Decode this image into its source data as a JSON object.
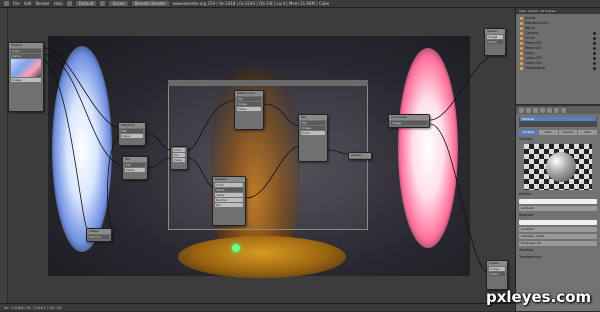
{
  "topbar": {
    "menus": [
      "File",
      "Add",
      "Render",
      "Help"
    ],
    "layout": "Default",
    "scene": "Scene",
    "engine": "Blender Render",
    "info": "www.blender.org 259 | Ve:3418 | Fa:3244 | Ob:1/8 | La:4 | Mem:31.84M | Cube"
  },
  "outliner": {
    "header_tabs": [
      "View",
      "Search",
      "All Scenes"
    ],
    "items": [
      "Scene",
      "RenderLayers",
      "World",
      "Camera",
      "Circle",
      "Plane.001",
      "Plane.002",
      "Lamp",
      "Lamp.001",
      "Lamp.002",
      "Trophy.Base"
    ]
  },
  "properties": {
    "material_name": "Material",
    "tabs": [
      "Surface",
      "Wire",
      "Volume",
      "Halo"
    ],
    "preview_title": "Preview",
    "diffuse_title": "Diffuse",
    "diffuse_shader": "Lambert",
    "specular_title": "Specular",
    "specular_shader": "CookTorr",
    "intensity_label": "Intensity: 0.500",
    "hardness_label": "Hardness: 50",
    "shading_title": "Shading",
    "transparency_title": "Transparency"
  },
  "nodes": {
    "texture_node_title": "Texture",
    "mapping_node_title": "Mapping",
    "mix_node_title": "Mix",
    "output_node_title": "Output",
    "material_node_title": "Material",
    "composite_title": "Composite",
    "viewer_title": "Viewer",
    "rgb_curves_title": "RGB Curves",
    "row_values": [
      "Color",
      "Alpha",
      "Image",
      "Fac",
      "Value",
      "Normal"
    ]
  },
  "statusbar": {
    "text": "Ve: 3,418/8 | Fa: 3,244/1 | Ob: 1/8"
  },
  "watermark": "pxleyes.com"
}
